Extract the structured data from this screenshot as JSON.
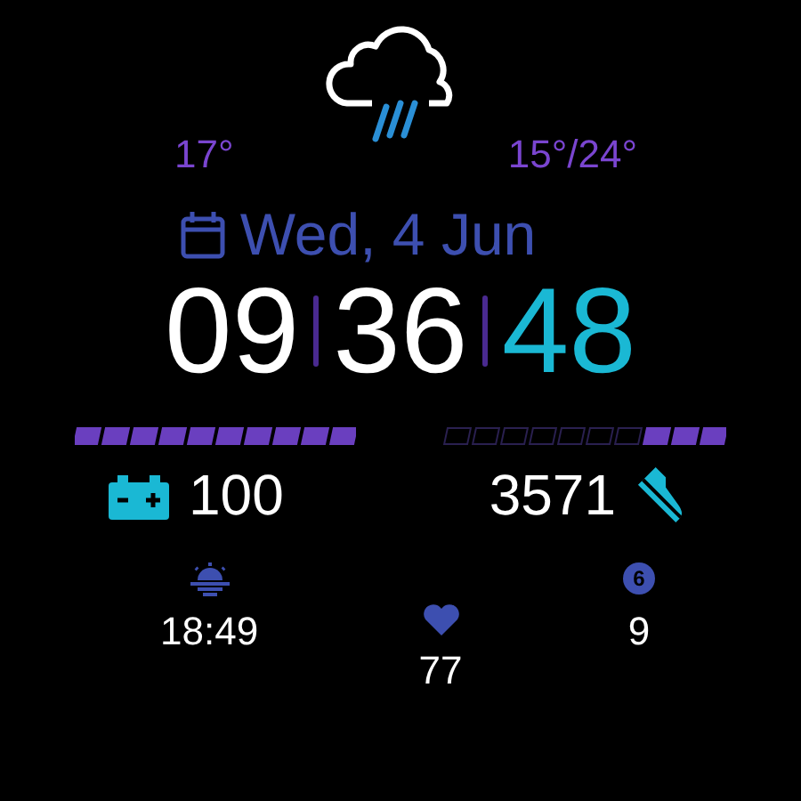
{
  "weather": {
    "current_temp": "17°",
    "range": "15°/24°"
  },
  "date": "Wed, 4 Jun",
  "time": {
    "hours": "09",
    "minutes": "36",
    "seconds": "48"
  },
  "bars": [
    {
      "level": 1,
      "kind": "forward"
    },
    {
      "level": 0.3,
      "kind": "reverse"
    }
  ],
  "battery": {
    "value": "100"
  },
  "steps": {
    "value": "3571"
  },
  "sunset": {
    "time": "18:49"
  },
  "heart_rate": {
    "value": "77"
  },
  "notifications": {
    "badge": "6",
    "value": "9"
  }
}
